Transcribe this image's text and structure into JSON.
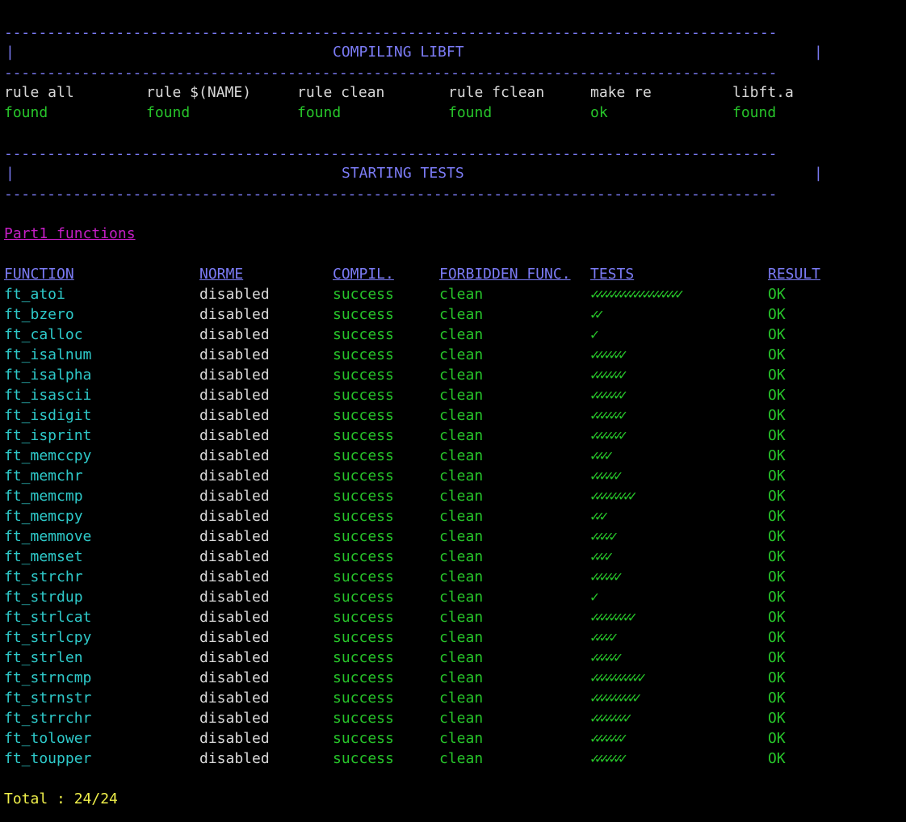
{
  "dash_line": "------------------------------------------------------------------------------------------",
  "bar_char": "|",
  "header1": {
    "title": "COMPILING LIBFT"
  },
  "rules": [
    {
      "name": "rule all",
      "status": "found"
    },
    {
      "name": "rule $(NAME)",
      "status": "found"
    },
    {
      "name": "rule clean",
      "status": "found"
    },
    {
      "name": "rule fclean",
      "status": "found"
    },
    {
      "name": "make re",
      "status": "ok"
    },
    {
      "name": "libft.a",
      "status": "found"
    }
  ],
  "header2": {
    "title": "STARTING TESTS"
  },
  "section_title": "Part1 functions",
  "columns": [
    "FUNCTION",
    "NORME",
    "COMPIL.",
    "FORBIDDEN FUNC.",
    "TESTS",
    "RESULT"
  ],
  "rows": [
    {
      "function": "ft_atoi",
      "norme": "disabled",
      "compil": "success",
      "forbidden": "clean",
      "tests": "✓✓✓✓✓✓✓✓✓✓✓✓✓✓✓✓✓✓✓",
      "result": "OK"
    },
    {
      "function": "ft_bzero",
      "norme": "disabled",
      "compil": "success",
      "forbidden": "clean",
      "tests": "✓✓",
      "result": "OK"
    },
    {
      "function": "ft_calloc",
      "norme": "disabled",
      "compil": "success",
      "forbidden": "clean",
      "tests": "✓",
      "result": "OK"
    },
    {
      "function": "ft_isalnum",
      "norme": "disabled",
      "compil": "success",
      "forbidden": "clean",
      "tests": "✓✓✓✓✓✓✓",
      "result": "OK"
    },
    {
      "function": "ft_isalpha",
      "norme": "disabled",
      "compil": "success",
      "forbidden": "clean",
      "tests": "✓✓✓✓✓✓✓",
      "result": "OK"
    },
    {
      "function": "ft_isascii",
      "norme": "disabled",
      "compil": "success",
      "forbidden": "clean",
      "tests": "✓✓✓✓✓✓✓",
      "result": "OK"
    },
    {
      "function": "ft_isdigit",
      "norme": "disabled",
      "compil": "success",
      "forbidden": "clean",
      "tests": "✓✓✓✓✓✓✓",
      "result": "OK"
    },
    {
      "function": "ft_isprint",
      "norme": "disabled",
      "compil": "success",
      "forbidden": "clean",
      "tests": "✓✓✓✓✓✓✓",
      "result": "OK"
    },
    {
      "function": "ft_memccpy",
      "norme": "disabled",
      "compil": "success",
      "forbidden": "clean",
      "tests": "✓✓✓✓",
      "result": "OK"
    },
    {
      "function": "ft_memchr",
      "norme": "disabled",
      "compil": "success",
      "forbidden": "clean",
      "tests": "✓✓✓✓✓✓",
      "result": "OK"
    },
    {
      "function": "ft_memcmp",
      "norme": "disabled",
      "compil": "success",
      "forbidden": "clean",
      "tests": "✓✓✓✓✓✓✓✓✓",
      "result": "OK"
    },
    {
      "function": "ft_memcpy",
      "norme": "disabled",
      "compil": "success",
      "forbidden": "clean",
      "tests": "✓✓✓",
      "result": "OK"
    },
    {
      "function": "ft_memmove",
      "norme": "disabled",
      "compil": "success",
      "forbidden": "clean",
      "tests": "✓✓✓✓✓",
      "result": "OK"
    },
    {
      "function": "ft_memset",
      "norme": "disabled",
      "compil": "success",
      "forbidden": "clean",
      "tests": "✓✓✓✓",
      "result": "OK"
    },
    {
      "function": "ft_strchr",
      "norme": "disabled",
      "compil": "success",
      "forbidden": "clean",
      "tests": "✓✓✓✓✓✓",
      "result": "OK"
    },
    {
      "function": "ft_strdup",
      "norme": "disabled",
      "compil": "success",
      "forbidden": "clean",
      "tests": "✓",
      "result": "OK"
    },
    {
      "function": "ft_strlcat",
      "norme": "disabled",
      "compil": "success",
      "forbidden": "clean",
      "tests": "✓✓✓✓✓✓✓✓✓",
      "result": "OK"
    },
    {
      "function": "ft_strlcpy",
      "norme": "disabled",
      "compil": "success",
      "forbidden": "clean",
      "tests": "✓✓✓✓✓",
      "result": "OK"
    },
    {
      "function": "ft_strlen",
      "norme": "disabled",
      "compil": "success",
      "forbidden": "clean",
      "tests": "✓✓✓✓✓✓",
      "result": "OK"
    },
    {
      "function": "ft_strncmp",
      "norme": "disabled",
      "compil": "success",
      "forbidden": "clean",
      "tests": "✓✓✓✓✓✓✓✓✓✓✓",
      "result": "OK"
    },
    {
      "function": "ft_strnstr",
      "norme": "disabled",
      "compil": "success",
      "forbidden": "clean",
      "tests": "✓✓✓✓✓✓✓✓✓✓",
      "result": "OK"
    },
    {
      "function": "ft_strrchr",
      "norme": "disabled",
      "compil": "success",
      "forbidden": "clean",
      "tests": "✓✓✓✓✓✓✓✓",
      "result": "OK"
    },
    {
      "function": "ft_tolower",
      "norme": "disabled",
      "compil": "success",
      "forbidden": "clean",
      "tests": "✓✓✓✓✓✓✓",
      "result": "OK"
    },
    {
      "function": "ft_toupper",
      "norme": "disabled",
      "compil": "success",
      "forbidden": "clean",
      "tests": "✓✓✓✓✓✓✓",
      "result": "OK"
    }
  ],
  "total": "Total : 24/24",
  "colors": {
    "background": "#000000",
    "header_blue": "#7b7bf5",
    "success_green": "#27c42a",
    "function_cyan": "#2ec9c9",
    "section_magenta": "#c51ec5",
    "total_yellow": "#f0f04a",
    "text_white": "#d8d8d8"
  }
}
